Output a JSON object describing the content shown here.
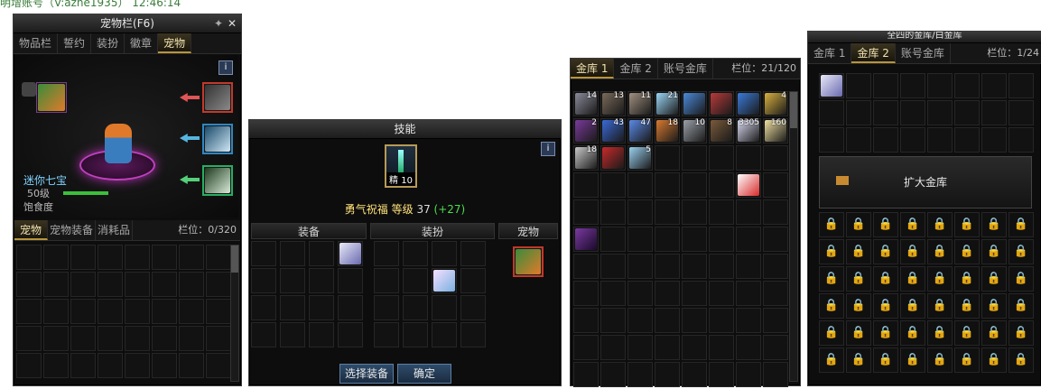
{
  "top_text": "明增账号（V:azhe1935）  12:46:14",
  "pet_window": {
    "title": "宠物栏(F6)",
    "tabs": [
      "物品栏",
      "誓约",
      "装扮",
      "徽章",
      "宠物"
    ],
    "active_tab": "宠物",
    "pet_name": "迷你七宝",
    "pet_level": "50级",
    "satiety_label": "饱食度",
    "inv_tabs": [
      "宠物",
      "宠物装备",
      "消耗品"
    ],
    "active_inv_tab": "宠物",
    "slot_info": "栏位：0/320",
    "info_icon": "i",
    "colors": {
      "red_slot": "#c0392b",
      "blue_slot": "#2e86c1",
      "green_slot": "#27ae60",
      "name": "#7fd3ff"
    }
  },
  "skill_window": {
    "title": "技能",
    "skill_level_badge": "精 10",
    "skill_name": "勇气祝福",
    "level_label": "等级",
    "level_value": "37",
    "level_bonus": "(+27)",
    "sections": [
      "装备",
      "装扮",
      "宠物"
    ],
    "select_button": "选择装备",
    "confirm_button": "确定",
    "info_icon": "i"
  },
  "vault_window": {
    "tabs": [
      "金库 1",
      "金库 2",
      "账号金库"
    ],
    "active_tab": "金库 1",
    "slot_info": "栏位：21/120",
    "items": [
      {
        "count": "14"
      },
      {
        "count": "13"
      },
      {
        "count": "11"
      },
      {
        "count": "21"
      },
      {
        "count": ""
      },
      {
        "count": ""
      },
      {
        "count": ""
      },
      {
        "count": "4"
      },
      {
        "count": "2"
      },
      {
        "count": "43"
      },
      {
        "count": "47"
      },
      {
        "count": "18"
      },
      {
        "count": "10"
      },
      {
        "count": "8"
      },
      {
        "count": "3305"
      },
      {
        "count": "160"
      },
      {
        "count": "18"
      },
      {
        "count": ""
      },
      {
        "count": "5"
      }
    ]
  },
  "account_vault_window": {
    "title": "全四的金库/白金库",
    "tabs": [
      "金库 1",
      "金库 2",
      "账号金库"
    ],
    "active_tab": "金库 2",
    "slot_info": "栏位：1/24",
    "expand_button": "扩大金库"
  }
}
